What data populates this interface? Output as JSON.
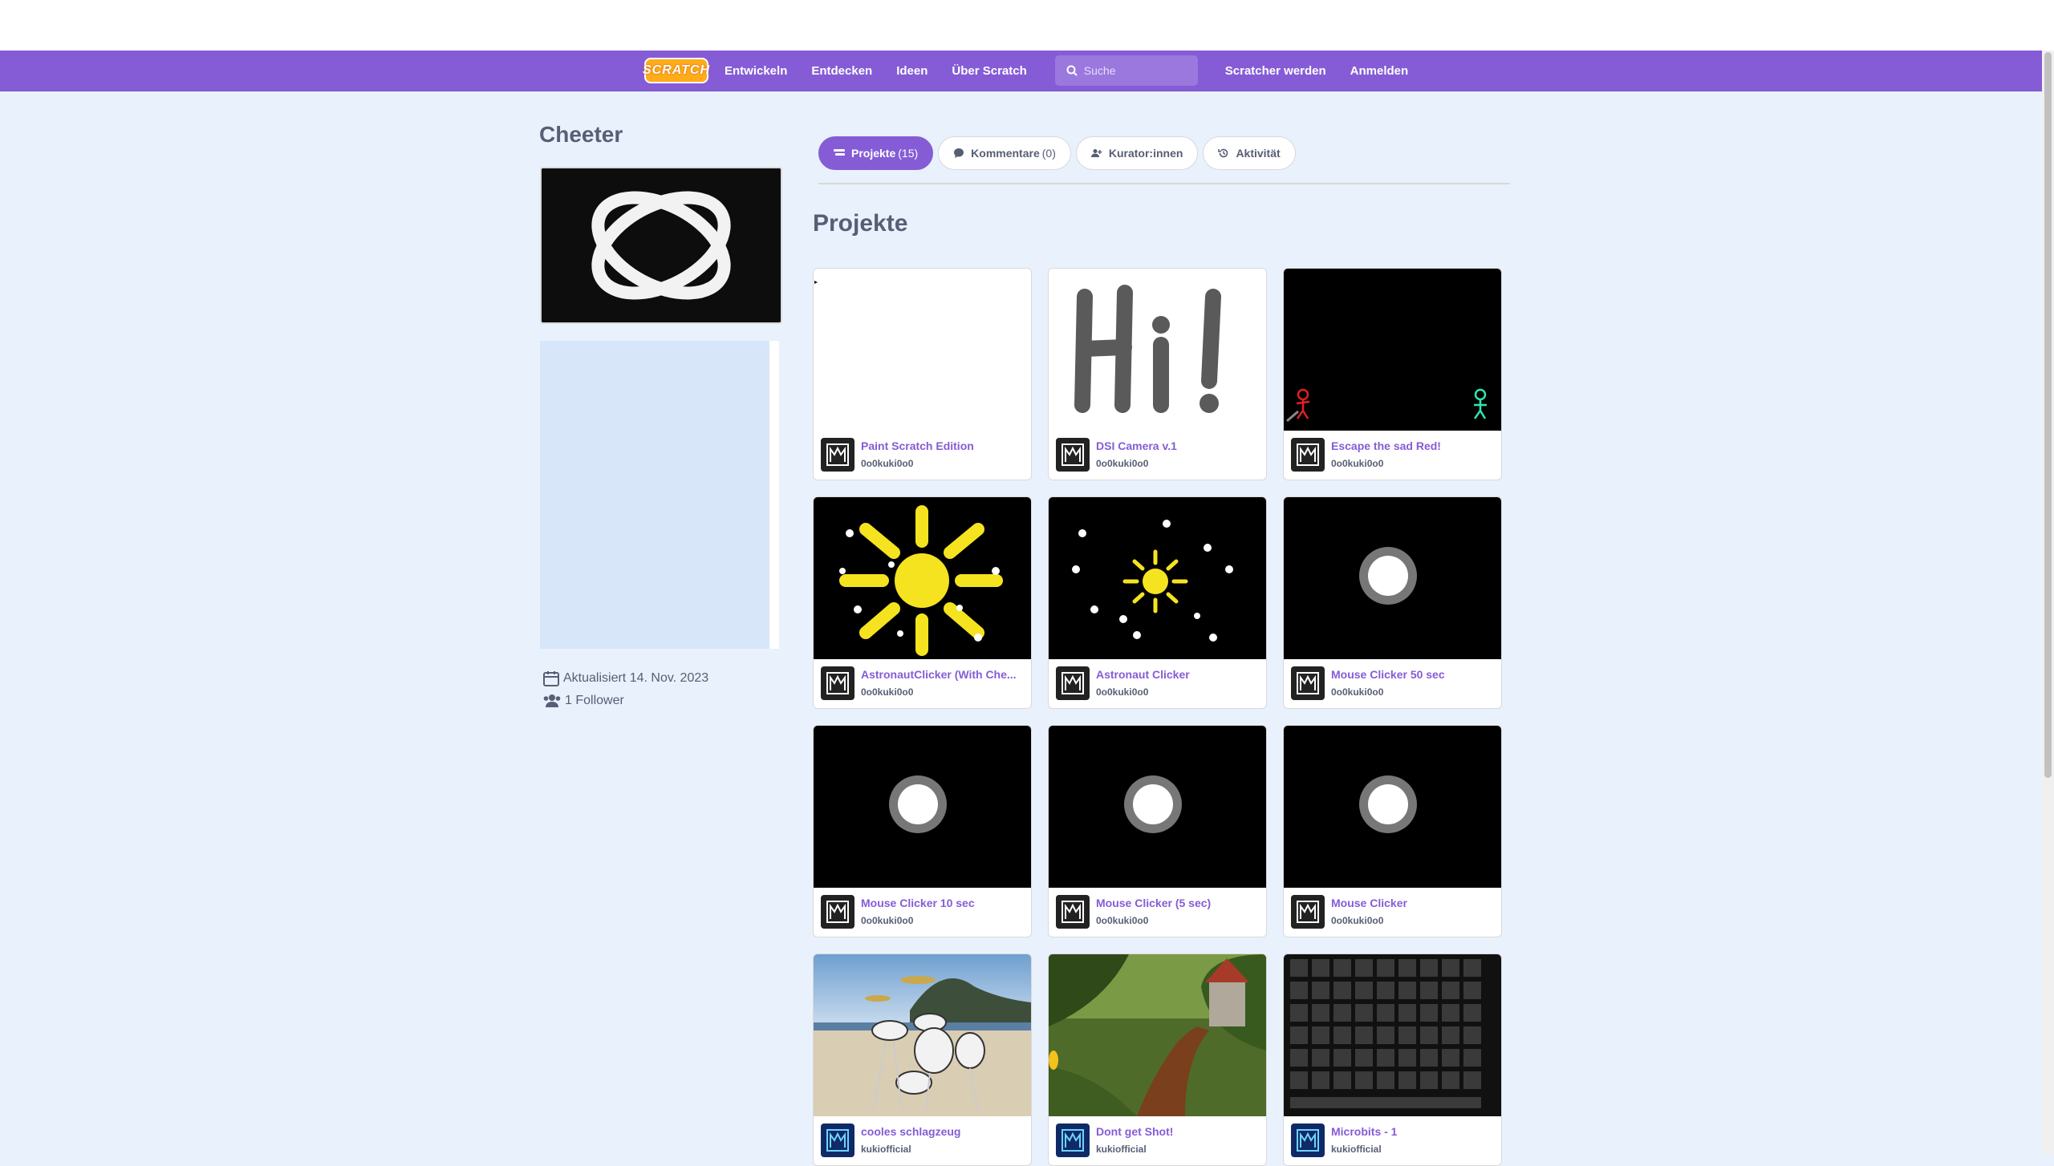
{
  "nav": {
    "logo": "SCRATCH",
    "links": [
      "Entwickeln",
      "Entdecken",
      "Ideen",
      "Über Scratch"
    ],
    "search_placeholder": "Suche",
    "join": "Scratcher werden",
    "signin": "Anmelden"
  },
  "profile": {
    "username": "Cheeter",
    "updated": "Aktualisiert 14. Nov. 2023",
    "followers": "1 Follower"
  },
  "tabs": [
    {
      "label": "Projekte",
      "count": "(15)"
    },
    {
      "label": "Kommentare",
      "count": "(0)"
    },
    {
      "label": "Kurator:innen",
      "count": ""
    },
    {
      "label": "Aktivität",
      "count": ""
    }
  ],
  "section_title": "Projekte",
  "projects": [
    {
      "title": "Paint Scratch Edition",
      "author": "0o0kuki0o0"
    },
    {
      "title": "DSI Camera v.1",
      "author": "0o0kuki0o0"
    },
    {
      "title": "Escape the sad Red!",
      "author": "0o0kuki0o0"
    },
    {
      "title": "AstronautClicker (With Che...",
      "author": "0o0kuki0o0"
    },
    {
      "title": "Astronaut Clicker",
      "author": "0o0kuki0o0"
    },
    {
      "title": "Mouse Clicker 50 sec",
      "author": "0o0kuki0o0"
    },
    {
      "title": "Mouse Clicker 10 sec",
      "author": "0o0kuki0o0"
    },
    {
      "title": "Mouse Clicker (5 sec)",
      "author": "0o0kuki0o0"
    },
    {
      "title": "Mouse Clicker",
      "author": "0o0kuki0o0"
    },
    {
      "title": "cooles schlagzeug",
      "author": "kukiofficial"
    },
    {
      "title": "Dont get Shot!",
      "author": "kukiofficial"
    },
    {
      "title": "Microbits - 1",
      "author": "kukiofficial"
    }
  ],
  "colors": {
    "brand": "#855cd6",
    "background": "#e9f1fc",
    "text": "#575e75"
  }
}
